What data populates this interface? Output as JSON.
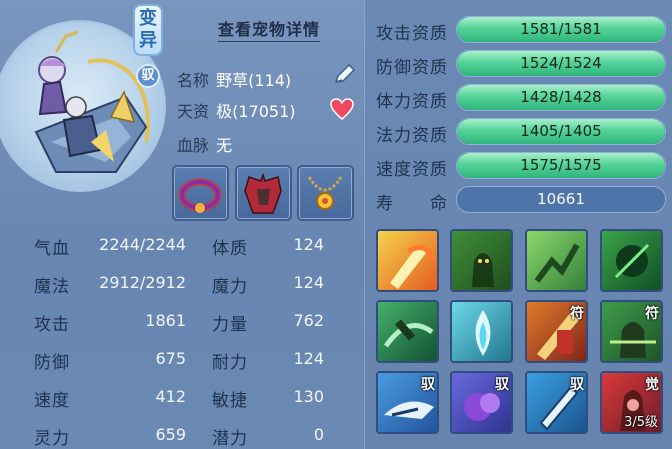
{
  "pet": {
    "badge_mutant": "变异",
    "badge_ride": "驭",
    "detail_link": "查看宠物详情",
    "name_label": "名称",
    "name_value": "野草(114)",
    "talent_label": "天资",
    "talent_value": "极(17051)",
    "blood_label": "血脉",
    "blood_value": "无"
  },
  "equipment": [
    {
      "name": "collar-item"
    },
    {
      "name": "armor-item"
    },
    {
      "name": "necklace-item"
    }
  ],
  "stats": [
    {
      "label": "气血",
      "value": "2244/2244",
      "label2": "体质",
      "value2": "124"
    },
    {
      "label": "魔法",
      "value": "2912/2912",
      "label2": "魔力",
      "value2": "124"
    },
    {
      "label": "攻击",
      "value": "1861",
      "label2": "力量",
      "value2": "762"
    },
    {
      "label": "防御",
      "value": "675",
      "label2": "耐力",
      "value2": "124"
    },
    {
      "label": "速度",
      "value": "412",
      "label2": "敏捷",
      "value2": "130"
    },
    {
      "label": "灵力",
      "value": "659",
      "label2": "潜力",
      "value2": "0"
    }
  ],
  "aptitudes": [
    {
      "label": "攻击资质",
      "text": "1581/1581",
      "fraction": 1.0
    },
    {
      "label": "防御资质",
      "text": "1524/1524",
      "fraction": 1.0
    },
    {
      "label": "体力资质",
      "text": "1428/1428",
      "fraction": 1.0
    },
    {
      "label": "法力资质",
      "text": "1405/1405",
      "fraction": 1.0
    },
    {
      "label": "速度资质",
      "text": "1575/1575",
      "fraction": 1.0
    }
  ],
  "lifespan": {
    "label": "寿　　命",
    "value": "10661"
  },
  "skills": [
    {
      "name": "fire-sword-skill",
      "tag": ""
    },
    {
      "name": "green-demon-skill",
      "tag": ""
    },
    {
      "name": "stealth-skill",
      "tag": ""
    },
    {
      "name": "green-beast-skill",
      "tag": ""
    },
    {
      "name": "whirlwind-skill",
      "tag": ""
    },
    {
      "name": "spirit-flame-skill",
      "tag": ""
    },
    {
      "name": "talisman-skill",
      "tag": "符"
    },
    {
      "name": "talisman-warrior-skill",
      "tag": "符"
    },
    {
      "name": "ride-wing-skill",
      "tag": "驭"
    },
    {
      "name": "ride-fist-skill",
      "tag": "驭"
    },
    {
      "name": "ride-blade-skill",
      "tag": "驭"
    },
    {
      "name": "awaken-skill",
      "tag": "觉",
      "level": "3/5级"
    }
  ],
  "colors": {
    "bar_fill": "#3fc486",
    "bg": "#6c8bb4"
  }
}
